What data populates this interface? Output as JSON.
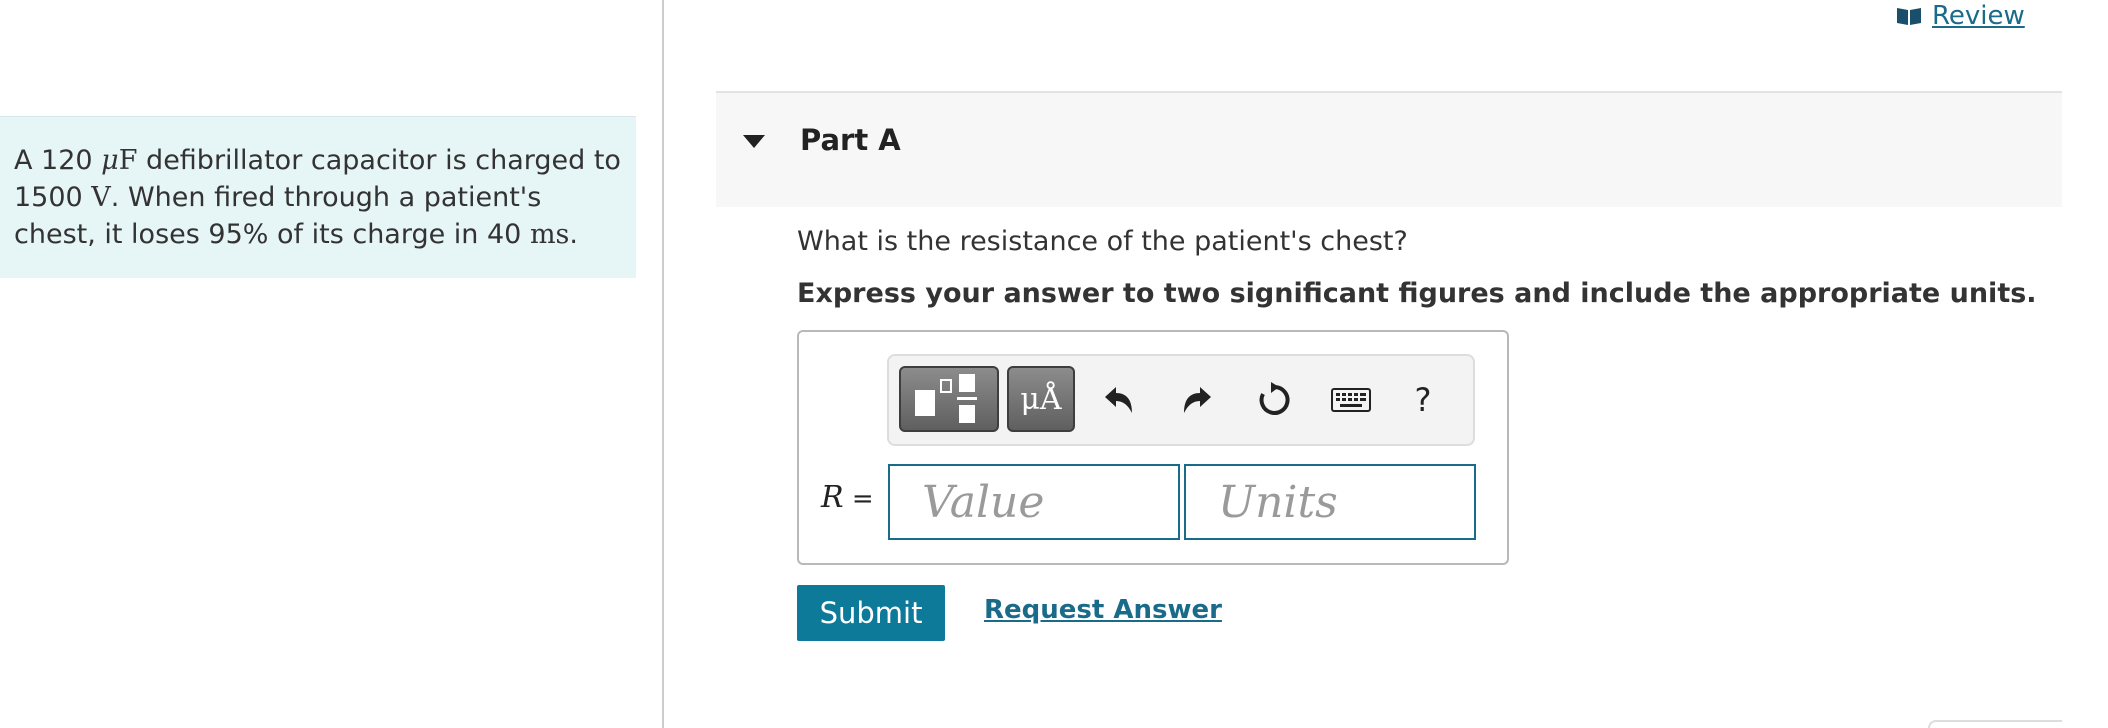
{
  "review": {
    "label": "Review",
    "icon": "book-icon"
  },
  "problem": {
    "t1": "A 120 ",
    "cap_unit_prefix": "μ",
    "cap_unit": "F",
    "t2": " defibrillator capacitor is charged to 1500 ",
    "volt_unit": "V",
    "t3": ". When fired through a patient's chest, it loses 95% of its charge in 40 ",
    "time_unit": "ms",
    "t4": "."
  },
  "part": {
    "title": "Part A"
  },
  "question": "What is the resistance of the patient's chest?",
  "instruction": "Express your answer to two significant figures and include the appropriate units.",
  "toolbar": {
    "units_label": "μÅ",
    "help_label": "?"
  },
  "answer": {
    "var_name": "R",
    "equals": " =",
    "value_placeholder": "Value",
    "units_placeholder": "Units"
  },
  "actions": {
    "submit_label": "Submit",
    "request_label": "Request Answer"
  },
  "colors": {
    "accent": "#0e7a99",
    "link": "#1a6b8a",
    "problem_bg": "#e6f5f6"
  }
}
